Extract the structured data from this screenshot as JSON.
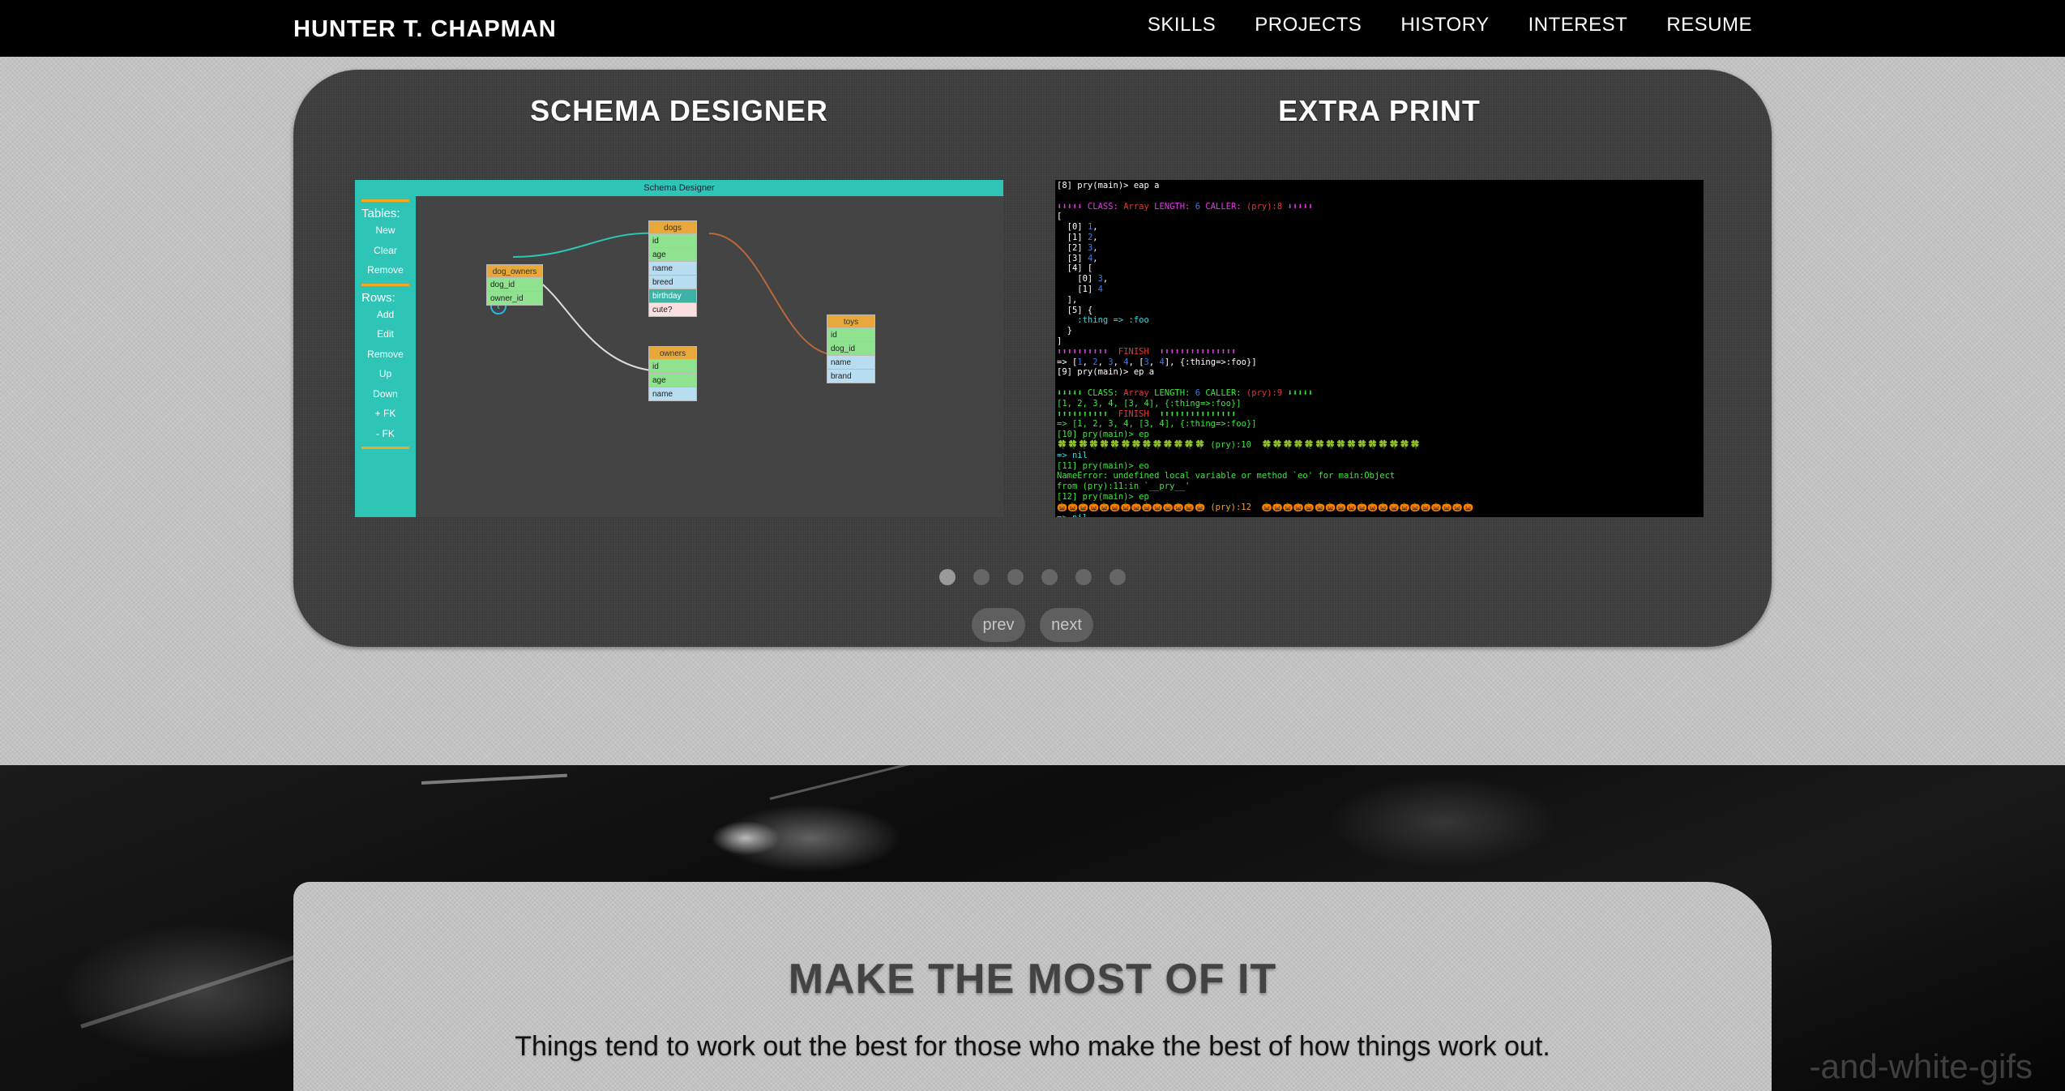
{
  "header": {
    "brand": "HUNTER T. CHAPMAN",
    "nav": [
      "SKILLS",
      "PROJECTS",
      "HISTORY",
      "INTEREST",
      "RESUME"
    ]
  },
  "slider": {
    "slides": [
      {
        "title": "SCHEMA DESIGNER",
        "app_title": "Schema Designer",
        "sidebar": {
          "tables_heading": "Tables:",
          "table_actions": [
            "New",
            "Clear",
            "Remove"
          ],
          "rows_heading": "Rows:",
          "row_actions": [
            "Add",
            "Edit",
            "Remove",
            "Up",
            "Down",
            "+ FK",
            "- FK"
          ]
        },
        "tables": {
          "dog_owners": {
            "name": "dog_owners",
            "rows": [
              "dog_id",
              "owner_id"
            ]
          },
          "dogs": {
            "name": "dogs",
            "rows": [
              "id",
              "age",
              "name",
              "breed",
              "birthday",
              "cute?"
            ]
          },
          "owners": {
            "name": "owners",
            "rows": [
              "id",
              "age",
              "name"
            ]
          },
          "toys": {
            "name": "toys",
            "rows": [
              "id",
              "dog_id",
              "name",
              "brand"
            ]
          }
        }
      },
      {
        "title": "EXTRA PRINT"
      }
    ],
    "dot_count": 6,
    "active_dot": 0,
    "prev_label": "prev",
    "next_label": "next"
  },
  "quote": {
    "title": "MAKE THE MOST OF IT",
    "text": "Things tend to work out the best for those who make the best of how things work out."
  },
  "background": {
    "watermark": "-and-white-gifs"
  }
}
